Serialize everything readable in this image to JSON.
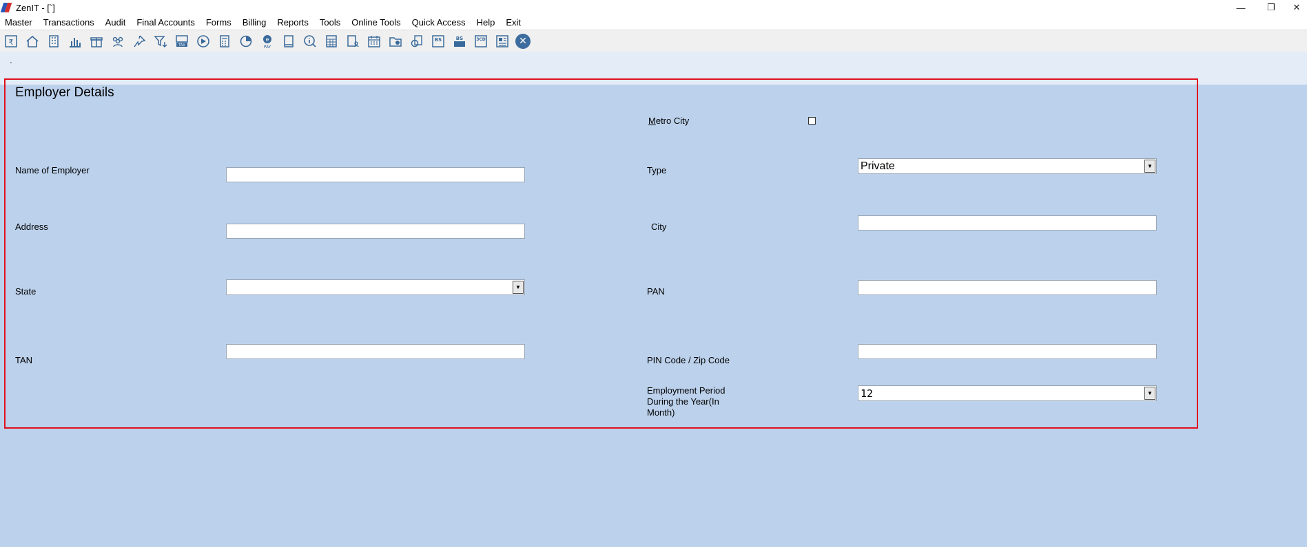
{
  "window": {
    "title": "ZenIT - [`]",
    "minimize": "—",
    "restore": "❐",
    "close": "✕"
  },
  "menu": [
    "Master",
    "Transactions",
    "Audit",
    "Final Accounts",
    "Forms",
    "Billing",
    "Reports",
    "Tools",
    "Online Tools",
    "Quick Access",
    "Help",
    "Exit"
  ],
  "toolbar": {
    "icons": [
      "rupee-doc-icon",
      "home-icon",
      "building-icon",
      "bar-chart-icon",
      "gift-icon",
      "users-icon",
      "pin-icon",
      "filter-icon",
      "tax-icon",
      "play-circle-icon",
      "calculator-icon",
      "pie-chart-icon",
      "epay-icon",
      "book-icon",
      "info-icon",
      "spreadsheet-icon",
      "user-doc-icon",
      "calendar-icon",
      "add-folder-icon",
      "refresh-doc-icon",
      "bs-icon",
      "bs-schedule-icon",
      "3cd-icon",
      "report-icon",
      "close-circle-icon"
    ],
    "labels": {
      "tax-icon": "TAX",
      "epay-icon": "PAY",
      "bs-icon": "BS",
      "bs-schedule-icon": "BS",
      "3cd-icon": "3CD"
    }
  },
  "strip": {
    "mark": "`"
  },
  "form": {
    "title": "Employer Details",
    "metro_city": {
      "label": "Metro City",
      "checked": false
    },
    "name_of_employer": {
      "label": "Name of Employer",
      "value": ""
    },
    "type": {
      "label": "Type",
      "value": "Private"
    },
    "address": {
      "label": "Address",
      "value": ""
    },
    "city": {
      "label": "City",
      "value": ""
    },
    "state": {
      "label": "State",
      "value": ""
    },
    "pan": {
      "label": "PAN",
      "value": ""
    },
    "tan": {
      "label": "TAN",
      "value": ""
    },
    "pin": {
      "label": "PIN Code / Zip Code",
      "value": ""
    },
    "employment_period": {
      "label_line1": "Employment Period",
      "label_line2": "During the Year(In",
      "label_line3": "Month)",
      "value": "12"
    }
  },
  "colors": {
    "background": "#bcd1eb",
    "frame": "#e0101e",
    "icon": "#3a6a9b"
  }
}
